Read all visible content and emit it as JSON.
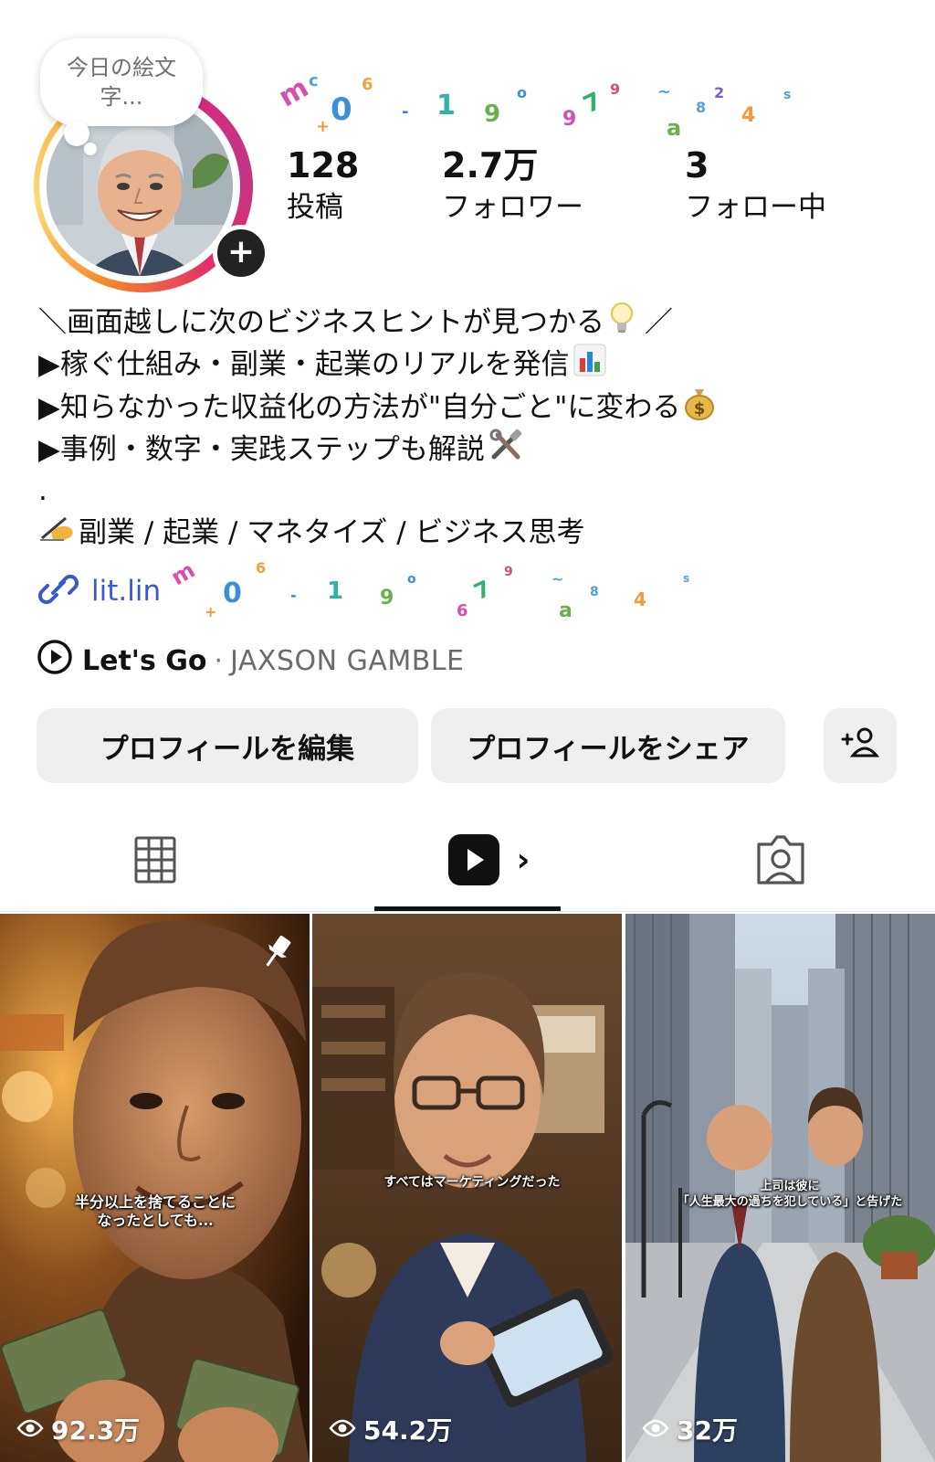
{
  "profile": {
    "note": "今日の絵文字...",
    "stats": [
      {
        "value": "128",
        "label": "投稿"
      },
      {
        "value": "2.7万",
        "label": "フォロワー"
      },
      {
        "value": "3",
        "label": "フォロー中"
      }
    ]
  },
  "bio": {
    "lines": [
      "＼画面越しに次のビジネスヒントが見つかる",
      "▶稼ぐ仕組み・副業・起業のリアルを発信",
      "▶知らなかった収益化の方法が\"自分ごと\"に変わる",
      "▶事例・数字・実践ステップも解説",
      ".",
      "副業 / 起業 / マネタイズ / ビジネス思考"
    ],
    "line1_suffix": "／",
    "link": "lit.lin"
  },
  "music": {
    "title": "Let's Go",
    "separator": "·",
    "artist": "JAXSON GAMBLE"
  },
  "buttons": {
    "edit": "プロフィールを編集",
    "share": "プロフィールをシェア"
  },
  "tabs": {
    "reels_chevron": "›"
  },
  "reels": [
    {
      "caption": "半分以上を捨てることに\nなったとしても...",
      "views": "92.3万",
      "pinned": true
    },
    {
      "caption": "すべてはマーケティングだった",
      "views": "54.2万",
      "pinned": false
    },
    {
      "caption": "上司は彼に\n「人生最大の過ちを犯している」と告げた",
      "views": "32万",
      "pinned": false
    }
  ],
  "colors": {
    "link": "#3a59d1",
    "button_bg": "#efefef",
    "story_ring": [
      "#f58529",
      "#feda77",
      "#dd2a7b",
      "#c13584"
    ]
  }
}
